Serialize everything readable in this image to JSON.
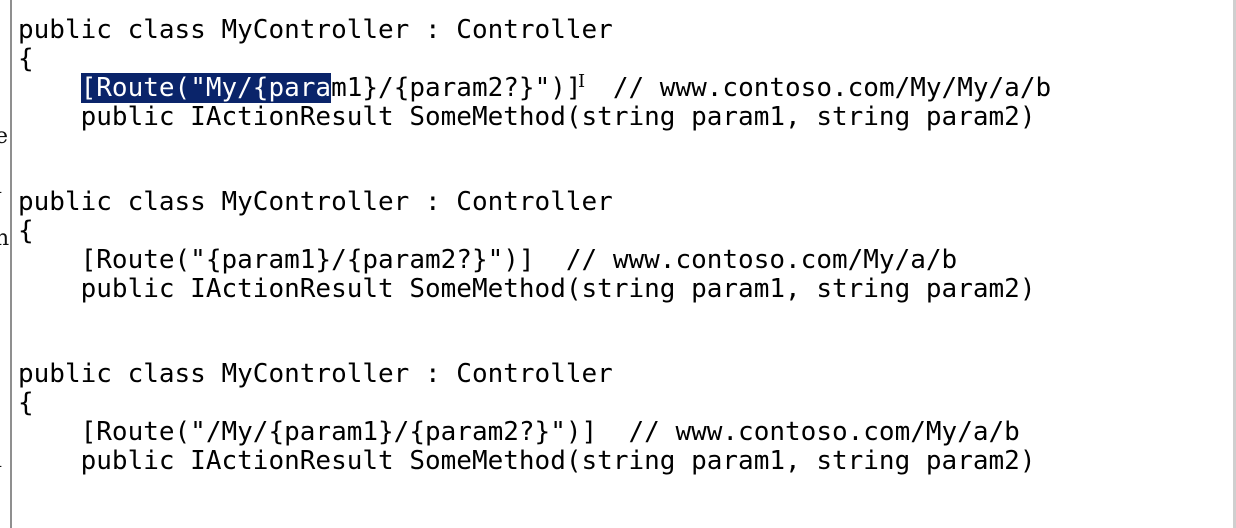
{
  "left_strip": {
    "glyphs": [
      "e",
      "l",
      "n",
      "l"
    ]
  },
  "code_blocks": [
    {
      "class_line": "public class MyController : Controller",
      "brace": "{",
      "route_selected": "[Route(\"My/{para",
      "route_rest": "m1}/{param2?}\")]  // www.contoso.com/My/My/a/b",
      "method_line": "    public IActionResult SomeMethod(string param1, string param2)"
    },
    {
      "class_line": "public class MyController : Controller",
      "brace": "{",
      "route_line": "    [Route(\"{param1}/{param2?}\")]  // www.contoso.com/My/a/b",
      "method_line": "    public IActionResult SomeMethod(string param1, string param2)"
    },
    {
      "class_line": "public class MyController : Controller",
      "brace": "{",
      "route_line": "    [Route(\"/My/{param1}/{param2?}\")]  // www.contoso.com/My/a/b",
      "method_line": "    public IActionResult SomeMethod(string param1, string param2)"
    }
  ],
  "colors": {
    "selection_background": "#0a246a",
    "selection_text": "#ffffff",
    "text": "#000000"
  },
  "cursor": {
    "icon": "text-cursor-icon",
    "glyph": "I"
  }
}
